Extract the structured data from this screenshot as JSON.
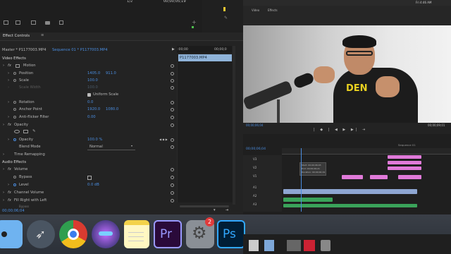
{
  "top": {
    "page_indicator": "1/2",
    "timecode": "00;00;05;19"
  },
  "effect_controls": {
    "panel_title": "Effect Controls",
    "source_label": "Master * P1177003.MP4",
    "sequence_label": "Sequence 01 * P1177003.MP4",
    "ruler_start": ":00;00",
    "ruler_end": "00;00;0",
    "clip_name": "P1177003.MP4",
    "video_effects_label": "Video Effects",
    "motion_label": "Motion",
    "position_label": "Position",
    "position_x": "1405.0",
    "position_y": "911.0",
    "scale_label": "Scale",
    "scale_value": "100.0",
    "scale_width_label": "Scale Width",
    "scale_width_value": "100.0",
    "uniform_scale_label": "Uniform Scale",
    "rotation_label": "Rotation",
    "rotation_value": "0.0",
    "anchor_label": "Anchor Point",
    "anchor_x": "1920.0",
    "anchor_y": "1080.0",
    "antiflicker_label": "Anti-flicker Filter",
    "antiflicker_value": "0.00",
    "opacity_group_label": "Opacity",
    "opacity_label": "Opacity",
    "opacity_value": "100.0 %",
    "blend_label": "Blend Mode",
    "blend_value": "Normal",
    "time_remap_label": "Time Remapping",
    "audio_effects_label": "Audio Effects",
    "volume_label": "Volume",
    "bypass_label": "Bypass",
    "level_label": "Level",
    "level_value": "0.0 dB",
    "channel_volume_label": "Channel Volume",
    "fill_right_label": "Fill Right with Left",
    "bypass2_label": "Bypass",
    "bottom_timecode": "00;00;06;04"
  },
  "program": {
    "tabs": [
      "Video",
      "Effects"
    ],
    "timecode_left": "00;00;06;04",
    "timecode_right": "00;00;09;01",
    "tshirt_text": "DEN"
  },
  "menubar": {
    "clock": "Fri 4:46 AM"
  },
  "timeline": {
    "current_time": "00;00;06;04",
    "seq_label": "Sequence 01",
    "tooltip_lines": [
      "Start: 00;00;06;03",
      "End: 00;00;06;21",
      "Duration: 00;00;00;19"
    ],
    "tracks": [
      "V3",
      "V2",
      "V1",
      "A1",
      "A2",
      "A3"
    ]
  },
  "dock": {
    "apps": [
      {
        "name": "Finder"
      },
      {
        "name": "Launchpad"
      },
      {
        "name": "Chrome"
      },
      {
        "name": "Siri"
      },
      {
        "name": "Notes"
      },
      {
        "name": "Premiere Pro",
        "label": "Pr"
      },
      {
        "name": "System Preferences",
        "badge": "2"
      },
      {
        "name": "Photoshop",
        "label": "Ps"
      }
    ]
  },
  "colors": {
    "accent": "#4a8de0",
    "premiere": "#9999ff",
    "photoshop": "#31a8ff",
    "pink_clip": "#e07ad9",
    "green_clip": "#3aa35a"
  }
}
